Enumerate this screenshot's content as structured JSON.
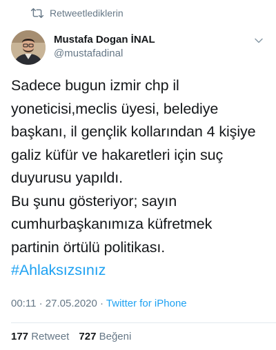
{
  "retweet_header": {
    "label": "Retweetlediklerin",
    "icon": "retweet-icon"
  },
  "author": {
    "display_name": "Mustafa Dogan İNAL",
    "handle": "@mustafadinal",
    "avatar_icon": "avatar-photo",
    "menu_icon": "chevron-down-icon"
  },
  "tweet": {
    "lines": [
      "Sadece bugun izmir chp il",
      "yoneticisi,meclis üyesi, belediye",
      "başkanı, il gençlik kollarından 4 kişiye",
      "galiz küfür ve hakaretleri için suç",
      "duyurusu yapıldı.",
      "Bu şunu gösteriyor; sayın",
      "cumhurbaşkanımıza küfretmek",
      "partinin örtülü politikası."
    ],
    "hashtag": "#Ahlaksızsınız"
  },
  "meta": {
    "time": "00:11",
    "separator1": " · ",
    "date": "27.05.2020",
    "separator2": " · ",
    "source": "Twitter for iPhone"
  },
  "stats": {
    "retweets_count": "177",
    "retweets_label": "Retweet",
    "likes_count": "727",
    "likes_label": "Beğeni"
  },
  "colors": {
    "accent": "#1da1f2",
    "secondary_text": "#657786",
    "primary_text": "#14171a",
    "divider": "#e1e8ed"
  }
}
